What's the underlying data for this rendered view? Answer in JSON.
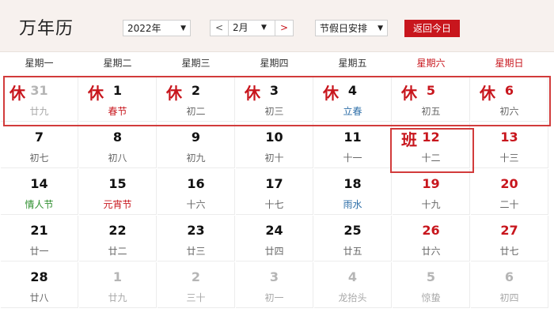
{
  "header": {
    "title": "万年历",
    "year": "2022年",
    "prev": "<",
    "month": "2月",
    "next": ">",
    "holiday_select": "节假日安排",
    "today_button": "返回今日"
  },
  "weekdays": [
    "星期一",
    "星期二",
    "星期三",
    "星期四",
    "星期五",
    "星期六",
    "星期日"
  ],
  "colors": {
    "accent": "#c8161d",
    "festival": "#2f6fa8",
    "valentine": "#2f8f2f"
  },
  "weeks": [
    [
      {
        "day": "31",
        "lunar": "廿九",
        "other": true,
        "tag": "休"
      },
      {
        "day": "1",
        "lunar": "春节",
        "tag": "休",
        "lunar_style": "festival-red"
      },
      {
        "day": "2",
        "lunar": "初二",
        "tag": "休"
      },
      {
        "day": "3",
        "lunar": "初三",
        "tag": "休"
      },
      {
        "day": "4",
        "lunar": "立春",
        "tag": "休",
        "lunar_style": "festival-blue"
      },
      {
        "day": "5",
        "lunar": "初五",
        "tag": "休",
        "weekend": true
      },
      {
        "day": "6",
        "lunar": "初六",
        "tag": "休",
        "weekend": true
      }
    ],
    [
      {
        "day": "7",
        "lunar": "初七"
      },
      {
        "day": "8",
        "lunar": "初八"
      },
      {
        "day": "9",
        "lunar": "初九"
      },
      {
        "day": "10",
        "lunar": "初十"
      },
      {
        "day": "11",
        "lunar": "十一"
      },
      {
        "day": "12",
        "lunar": "十二",
        "tag": "班",
        "weekend": true
      },
      {
        "day": "13",
        "lunar": "十三",
        "weekend": true
      }
    ],
    [
      {
        "day": "14",
        "lunar": "情人节",
        "lunar_style": "festival-green"
      },
      {
        "day": "15",
        "lunar": "元宵节",
        "lunar_style": "festival-red"
      },
      {
        "day": "16",
        "lunar": "十六"
      },
      {
        "day": "17",
        "lunar": "十七"
      },
      {
        "day": "18",
        "lunar": "雨水",
        "lunar_style": "festival-blue"
      },
      {
        "day": "19",
        "lunar": "十九",
        "weekend": true
      },
      {
        "day": "20",
        "lunar": "二十",
        "weekend": true
      }
    ],
    [
      {
        "day": "21",
        "lunar": "廿一"
      },
      {
        "day": "22",
        "lunar": "廿二"
      },
      {
        "day": "23",
        "lunar": "廿三"
      },
      {
        "day": "24",
        "lunar": "廿四"
      },
      {
        "day": "25",
        "lunar": "廿五"
      },
      {
        "day": "26",
        "lunar": "廿六",
        "weekend": true
      },
      {
        "day": "27",
        "lunar": "廿七",
        "weekend": true
      }
    ],
    [
      {
        "day": "28",
        "lunar": "廿八"
      },
      {
        "day": "1",
        "lunar": "廿九",
        "other": true
      },
      {
        "day": "2",
        "lunar": "三十",
        "other": true
      },
      {
        "day": "3",
        "lunar": "初一",
        "other": true
      },
      {
        "day": "4",
        "lunar": "龙抬头",
        "other": true
      },
      {
        "day": "5",
        "lunar": "惊蛰",
        "other": true
      },
      {
        "day": "6",
        "lunar": "初四",
        "other": true
      }
    ]
  ]
}
